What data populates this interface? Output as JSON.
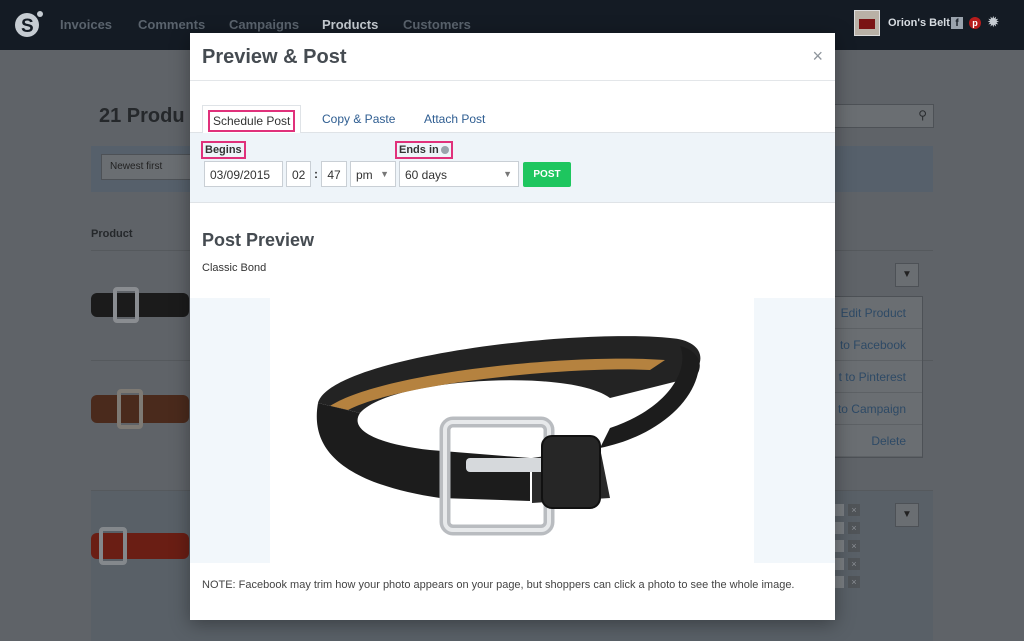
{
  "nav": {
    "items": [
      "Invoices",
      "Comments",
      "Campaigns",
      "Products",
      "Customers"
    ],
    "active": "Products",
    "store_name": "Orion's Belt",
    "facebook_glyph": "f",
    "pinterest_glyph": "p",
    "gear_glyph": "✹"
  },
  "background": {
    "title": "21 Produ",
    "sort_label": "Newest first",
    "column_label": "Product",
    "menu_items": [
      "Edit Product",
      "to Facebook",
      "t to Pinterest",
      "to Campaign",
      "Delete"
    ]
  },
  "modal": {
    "title": "Preview & Post",
    "close_glyph": "×",
    "tabs": [
      "Schedule Post",
      "Copy & Paste",
      "Attach Post"
    ],
    "schedule": {
      "begins_label": "Begins",
      "date": "03/09/2015",
      "hour": "02",
      "time_sep": ":",
      "minute": "47",
      "ampm": "pm",
      "ends_label": "Ends in",
      "duration": "60 days",
      "post_label": "POST"
    },
    "preview_title": "Post Preview",
    "product_name": "Classic Bond",
    "note": "NOTE: Facebook may trim how your photo appears on your page, but shoppers can click a photo to see the whole image."
  },
  "colors": {
    "nav_bg": "#141b24",
    "accent_highlight": "#e0317b",
    "post_button": "#1ec65f",
    "link": "#2e5d91"
  }
}
